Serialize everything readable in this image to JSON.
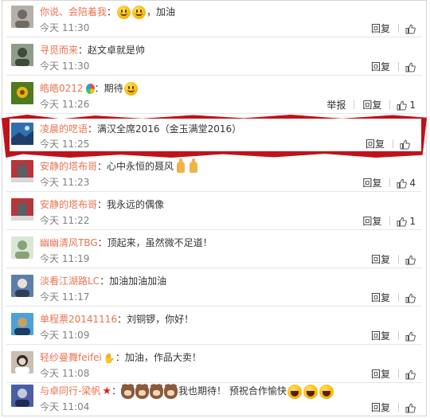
{
  "colors": {
    "username": "#eb7350",
    "time": "#808080",
    "highlight": "#c0121a"
  },
  "labels": {
    "reply": "回复",
    "report": "举报",
    "separator": "："
  },
  "comments": [
    {
      "user": "你说、会陪着我",
      "text": "，加油",
      "time": "今天 11:30",
      "likes": "",
      "emojis": "smile2",
      "report": false
    },
    {
      "user": "寻觅而来",
      "text": "赵文卓就是帅",
      "time": "今天 11:30",
      "likes": "",
      "report": false
    },
    {
      "user": "皓皓0212",
      "text": "期待",
      "time": "今天 11:26",
      "likes": "1",
      "report": true
    },
    {
      "user": "凌晨的呓语",
      "text": "满汉全席2016（金玉满堂2016）",
      "time": "今天 11:25",
      "likes": "",
      "report": false,
      "highlighted": true
    },
    {
      "user": "安静的塔布哥",
      "text": "心中永恒的聂风",
      "time": "今天 11:23",
      "likes": "4",
      "report": false
    },
    {
      "user": "安静的塔布哥",
      "text": "我永远的偶像",
      "time": "今天 11:22",
      "likes": "1",
      "report": false
    },
    {
      "user": "幽幽清风TBG",
      "text": "顶起来，虽然微不足道！",
      "time": "今天 11:19",
      "likes": "",
      "report": false
    },
    {
      "user": "淡看江湖路LC",
      "text": "加油加油加油",
      "time": "今天 11:17",
      "likes": "",
      "report": false
    },
    {
      "user": "单程票20141116",
      "text": "刘铜锣，你好！",
      "time": "今天 11:09",
      "likes": "",
      "report": false
    },
    {
      "user": "轻纱曼舞feifei",
      "text": "加油，作品大卖！",
      "time": "今天 11:08",
      "likes": "",
      "report": false
    },
    {
      "user": "与卓同行-梁帆",
      "text": "我也期待！ 预祝合作愉快",
      "time": "今天 11:04",
      "likes": "",
      "report": false
    }
  ],
  "avatars": [
    {
      "icon": "avatar-icon",
      "bg": "#b5b0a8",
      "fg": "#6e6a64"
    },
    {
      "icon": "avatar-icon",
      "bg": "#8f9c8a",
      "fg": "#3f4a3b"
    },
    {
      "icon": "avatar-icon",
      "bg": "#e8b21a",
      "fg": "#4f7a1e"
    },
    {
      "icon": "avatar-icon",
      "bg": "#2f6fb0",
      "fg": "#123456"
    },
    {
      "icon": "avatar-icon",
      "bg": "#b9353a",
      "fg": "#5b5f66"
    },
    {
      "icon": "avatar-icon",
      "bg": "#b9353a",
      "fg": "#5b5f66"
    },
    {
      "icon": "avatar-icon",
      "bg": "#88a27a",
      "fg": "#dce6d6"
    },
    {
      "icon": "avatar-icon",
      "bg": "#5e7eaa",
      "fg": "#e9e2d4"
    },
    {
      "icon": "avatar-icon",
      "bg": "#4fa0d8",
      "fg": "#c8a060"
    },
    {
      "icon": "avatar-icon",
      "bg": "#c9bfb3",
      "fg": "#2a2a2a"
    },
    {
      "icon": "avatar-icon",
      "bg": "#4a5ea8",
      "fg": "#c9c9d6"
    }
  ]
}
